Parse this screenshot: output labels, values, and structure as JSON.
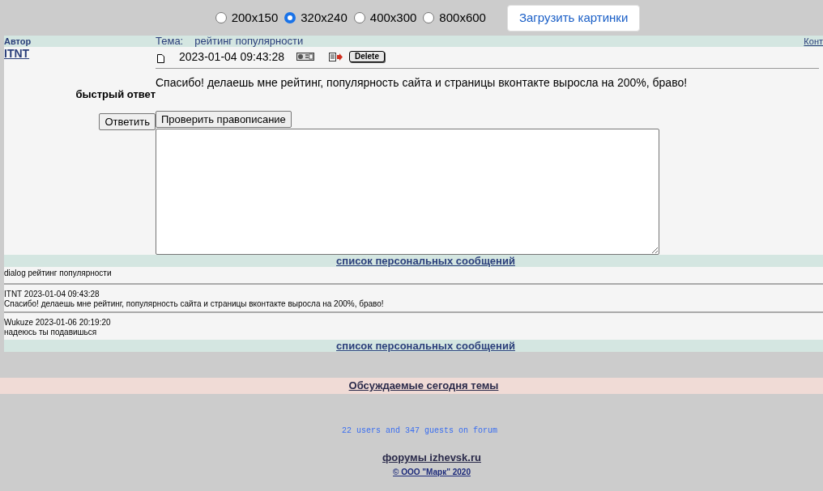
{
  "size_options": [
    {
      "label": "200x150",
      "selected": false
    },
    {
      "label": "320x240",
      "selected": true
    },
    {
      "label": "400x300",
      "selected": false
    },
    {
      "label": "800x600",
      "selected": false
    }
  ],
  "load_button": "Загрузить картинки",
  "header": {
    "author_label": "Автор",
    "topic_label": "Тема:",
    "topic": "рейтинг популярности",
    "right_link": "Конт"
  },
  "post": {
    "author": "ITNT",
    "date": "2023-01-04 09:43:28",
    "delete_button": "Delete",
    "text": "Спасибо! делаешь мне рейтинг, популярность сайта и страницы вконтакте выросла на 200%, браво!"
  },
  "quick_reply": {
    "title": "быстрый ответ",
    "reply_button": "Ответить",
    "spellcheck_button": "Проверить правописание"
  },
  "pm_link": "список персональных сообщений",
  "dialog_title": "dialog рейтинг популярности",
  "messages": [
    {
      "header": "ITNT 2023-01-04 09:43:28",
      "text": "Спасибо! делаешь мне рейтинг, популярность сайта и страницы вконтакте выросла на 200%, браво!"
    },
    {
      "header": "Wukuze 2023-01-06 20:19:20",
      "text": "надеюсь ты подавишься"
    }
  ],
  "pm_link_bottom": "список персональных сообщений",
  "today_topics": "Обсуждаемые сегодня темы",
  "online": "22 users and 347 guests on forum",
  "site_link": "форумы izhevsk.ru",
  "copyright": "© ООО \"Марк\" 2020"
}
